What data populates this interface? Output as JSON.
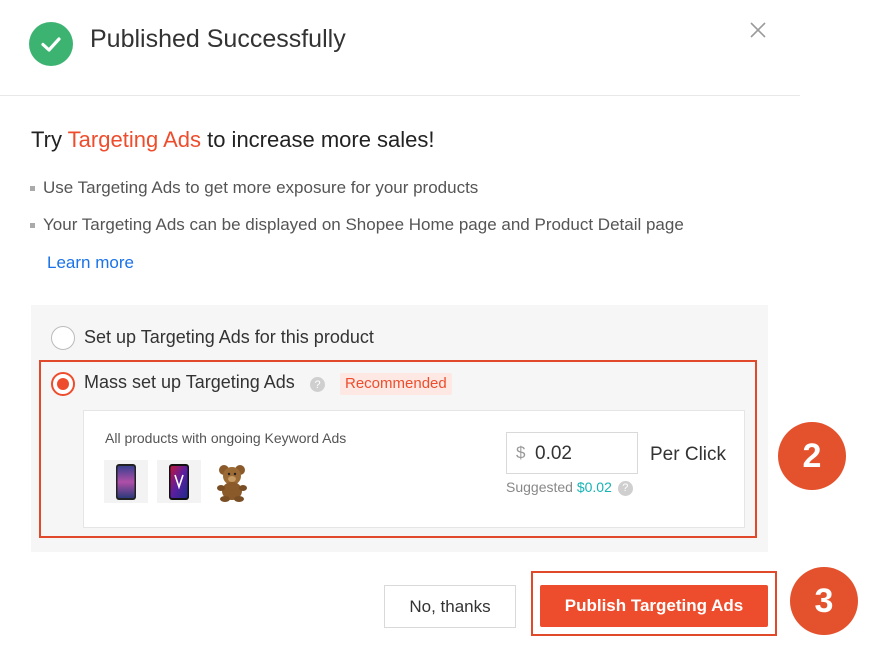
{
  "dialog": {
    "title": "Published Successfully",
    "status_color": "#3cb371",
    "accent_color": "#ee4d2d"
  },
  "promo": {
    "title_prefix": "Try ",
    "title_highlight": "Targeting Ads",
    "title_suffix": " to increase more sales!",
    "bullets": [
      "Use Targeting Ads to get more exposure for your products",
      "Your Targeting Ads can be displayed on Shopee Home page and Product Detail page"
    ],
    "learn_more": "Learn more"
  },
  "options": {
    "single": {
      "label": "Set up Targeting Ads for this product",
      "selected": false
    },
    "mass": {
      "label": "Mass set up Targeting Ads",
      "badge": "Recommended",
      "selected": true
    }
  },
  "mass_card": {
    "label": "All products with ongoing Keyword Ads",
    "thumbnails": [
      "phone-purple-icon",
      "phone-red-icon",
      "teddy-bear-icon"
    ],
    "currency": "$",
    "bid_value": "0.02",
    "per_click": "Per Click",
    "suggested_label": "Suggested",
    "suggested_value": "$0.02"
  },
  "markers": [
    "2",
    "3"
  ],
  "buttons": {
    "cancel": "No, thanks",
    "publish": "Publish Targeting Ads"
  }
}
